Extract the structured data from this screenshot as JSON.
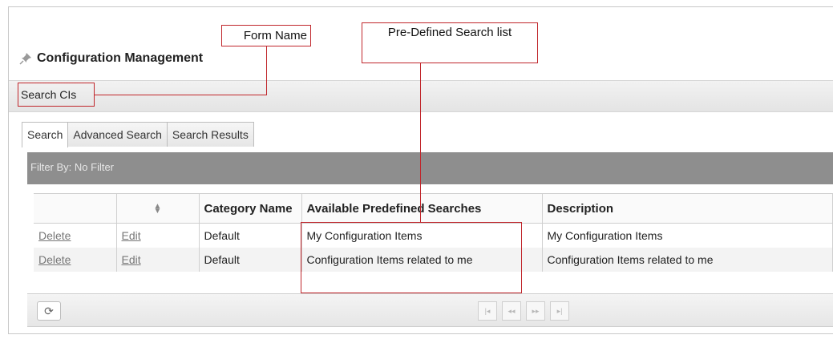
{
  "annotations": {
    "form_name_callout": "Form Name",
    "predefined_callout": "Pre-Defined Search list"
  },
  "page_title": "Configuration Management",
  "breadcrumb": "Search CIs",
  "tabs": [
    {
      "label": "Search",
      "active": true
    },
    {
      "label": "Advanced Search",
      "active": false
    },
    {
      "label": "Search Results",
      "active": false
    }
  ],
  "filter_text": "Filter By: No Filter",
  "grid": {
    "columns": [
      "",
      "",
      "Category Name",
      "Available Predefined Searches",
      "Description"
    ],
    "rows": [
      {
        "delete": "Delete",
        "edit": "Edit",
        "category": "Default",
        "search": "My Configuration Items",
        "description": "My Configuration Items"
      },
      {
        "delete": "Delete",
        "edit": "Edit",
        "category": "Default",
        "search": "Configuration Items related to me",
        "description": "Configuration Items related to me"
      }
    ]
  },
  "footer": {
    "refresh_icon": "refresh-icon",
    "pager": [
      "first-page-icon",
      "prev-page-icon",
      "next-page-icon",
      "last-page-icon"
    ]
  },
  "colors": {
    "callout": "#c0262b",
    "filter_bar": "#8e8e8e"
  }
}
